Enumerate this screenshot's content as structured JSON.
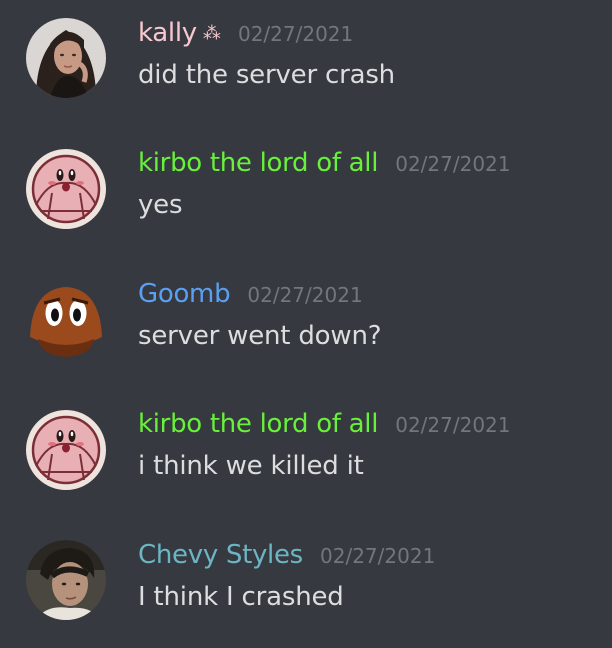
{
  "colors": {
    "background": "#36393f",
    "timestamp": "#72767d",
    "message_text": "#dcddde"
  },
  "messages": [
    {
      "author": "kally",
      "author_suffix": "⁂",
      "author_color": "#f8c8d0",
      "timestamp": "02/27/2021",
      "text": "did the server crash",
      "avatar": "kally-avatar"
    },
    {
      "author": "kirbo the lord of all",
      "author_color": "#69f03a",
      "timestamp": "02/27/2021",
      "text": "yes",
      "avatar": "kirby-avatar"
    },
    {
      "author": "Goomb",
      "author_color": "#5aa0f2",
      "timestamp": "02/27/2021",
      "text": "server went down?",
      "avatar": "goomba-avatar"
    },
    {
      "author": "kirbo the lord of all",
      "author_color": "#69f03a",
      "timestamp": "02/27/2021",
      "text": "i think we killed it",
      "avatar": "kirby-avatar"
    },
    {
      "author": "Chevy Styles",
      "author_color": "#6cb6c4",
      "timestamp": "02/27/2021",
      "text": "I think I crashed",
      "avatar": "chevy-avatar"
    }
  ]
}
